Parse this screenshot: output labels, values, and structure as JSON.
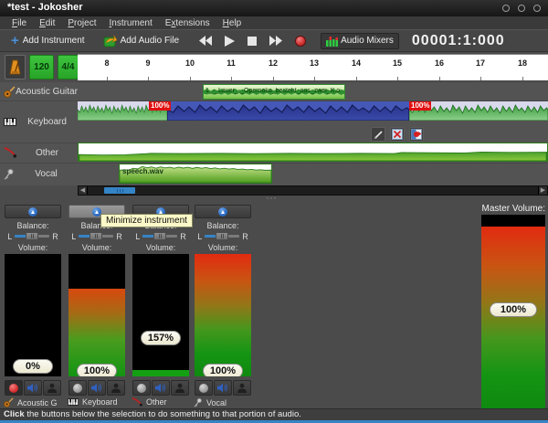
{
  "window": {
    "title": "*test - Jokosher"
  },
  "menu": {
    "items": [
      {
        "pre": "",
        "key": "F",
        "post": "ile"
      },
      {
        "pre": "",
        "key": "E",
        "post": "dit"
      },
      {
        "pre": "",
        "key": "P",
        "post": "roject"
      },
      {
        "pre": "",
        "key": "I",
        "post": "nstrument"
      },
      {
        "pre": "E",
        "key": "x",
        "post": "tensions"
      },
      {
        "pre": "",
        "key": "H",
        "post": "elp"
      }
    ]
  },
  "toolbar": {
    "add_instrument_label": "Add Instrument",
    "add_audio_file_label": "Add Audio File",
    "audio_mixers_label": "Audio Mixers",
    "timecode": "00001:1:000"
  },
  "ruler": {
    "bpm": "120",
    "time_signature": "4/4",
    "numbers": [
      "8",
      "9",
      "10",
      "11",
      "12",
      "13",
      "14",
      "15",
      "16",
      "17",
      "18"
    ]
  },
  "tracks": [
    {
      "name": "Acoustic Guitar",
      "clip": "1_-_Lauer_-_Opernoko_besteht_aus_zwei_K.o"
    },
    {
      "name": "Keyboard",
      "sel_start": "100%",
      "sel_end": "100%"
    },
    {
      "name": "Other"
    },
    {
      "name": "Vocal",
      "clip": "speech.wav"
    }
  ],
  "tooltip": {
    "text": "Minimize instrument"
  },
  "mixer": {
    "balance_label": "Balance:",
    "volume_label": "Volume:",
    "left": "L",
    "right": "R",
    "strips": [
      {
        "name": "Acoustic G",
        "volume": "0%"
      },
      {
        "name": "Keyboard",
        "volume": "100%"
      },
      {
        "name": "Other",
        "volume": "157%"
      },
      {
        "name": "Vocal",
        "volume": "100%"
      }
    ],
    "master": {
      "label": "Master Volume:",
      "volume": "100%"
    }
  },
  "statusbar": {
    "bold": "Click",
    "rest": " the buttons below the selection to do something to that portion of audio."
  },
  "colors": {
    "accent_blue": "#3584c6",
    "selection_blue": "#4558b8",
    "record_red": "#d83030",
    "badge_red": "#e01010",
    "clip_green": "#57a020",
    "button_green": "#2eb82e",
    "meter_top_red": "#e22b10",
    "meter_bottom_green": "#0f8a10",
    "tooltip_yellow": "#fcf9c9"
  }
}
